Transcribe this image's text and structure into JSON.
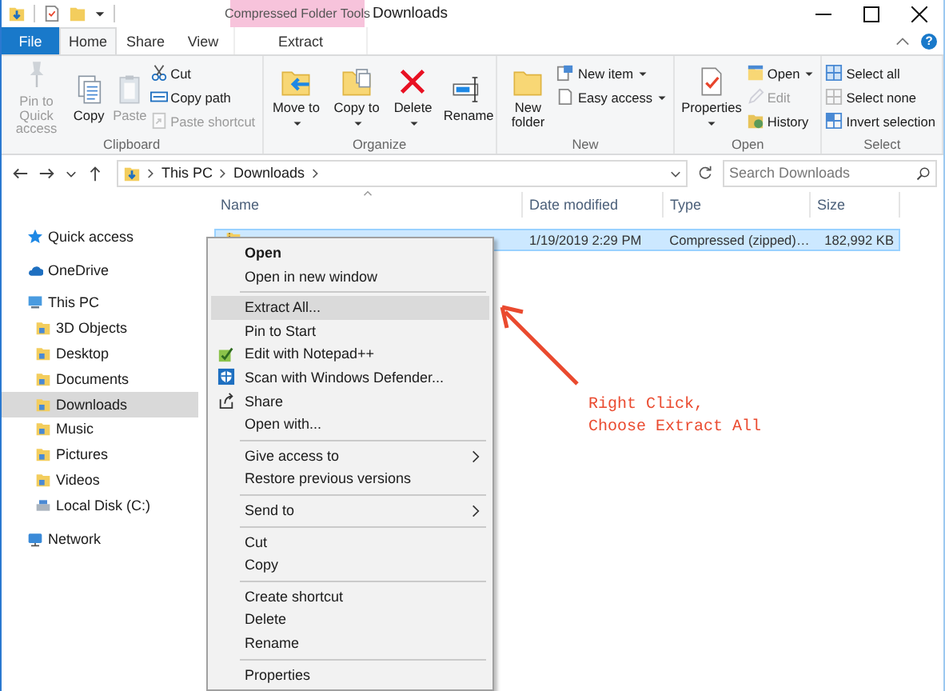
{
  "window": {
    "title": "Downloads",
    "context_tab_group": "Compressed Folder Tools",
    "help": "?"
  },
  "ribbon_tabs": [
    {
      "label": "File",
      "kind": "file",
      "selected": false
    },
    {
      "label": "Home",
      "kind": "tab",
      "selected": true
    },
    {
      "label": "Share",
      "kind": "tab",
      "selected": false
    },
    {
      "label": "View",
      "kind": "tab",
      "selected": false
    },
    {
      "label": "Extract",
      "kind": "context",
      "selected": false
    }
  ],
  "ribbon_groups": [
    {
      "label": "Clipboard",
      "columns": [
        {
          "kind": "large",
          "commands": [
            {
              "label": "Pin to Quick access",
              "disabled": true,
              "dropdown": false
            }
          ]
        },
        {
          "kind": "large",
          "commands": [
            {
              "label": "Copy",
              "disabled": false,
              "dropdown": false
            }
          ]
        },
        {
          "kind": "large",
          "commands": [
            {
              "label": "Paste",
              "disabled": true,
              "dropdown": false
            }
          ]
        },
        {
          "kind": "stack",
          "commands": [
            {
              "label": "Cut",
              "disabled": false,
              "dropdown": false
            },
            {
              "label": "Copy path",
              "disabled": false,
              "dropdown": false
            },
            {
              "label": "Paste shortcut",
              "disabled": true,
              "dropdown": false
            }
          ]
        }
      ]
    },
    {
      "label": "Organize",
      "columns": [
        {
          "kind": "large",
          "commands": [
            {
              "label": "Move to",
              "disabled": false,
              "dropdown": true
            }
          ]
        },
        {
          "kind": "large",
          "commands": [
            {
              "label": "Copy to",
              "disabled": false,
              "dropdown": true
            }
          ]
        },
        {
          "kind": "large",
          "commands": [
            {
              "label": "Delete",
              "disabled": false,
              "dropdown": true
            }
          ]
        },
        {
          "kind": "large",
          "commands": [
            {
              "label": "Rename",
              "disabled": false,
              "dropdown": false
            }
          ]
        }
      ]
    },
    {
      "label": "New",
      "columns": [
        {
          "kind": "large",
          "commands": [
            {
              "label": "New folder",
              "disabled": false,
              "dropdown": false
            }
          ]
        },
        {
          "kind": "stack",
          "commands": [
            {
              "label": "New item",
              "disabled": false,
              "dropdown": true
            },
            {
              "label": "Easy access",
              "disabled": false,
              "dropdown": true
            }
          ]
        }
      ]
    },
    {
      "label": "Open",
      "columns": [
        {
          "kind": "large",
          "commands": [
            {
              "label": "Properties",
              "disabled": false,
              "dropdown": true
            }
          ]
        },
        {
          "kind": "stack",
          "commands": [
            {
              "label": "Open",
              "disabled": false,
              "dropdown": true
            },
            {
              "label": "Edit",
              "disabled": true,
              "dropdown": false
            },
            {
              "label": "History",
              "disabled": false,
              "dropdown": false
            }
          ]
        }
      ]
    },
    {
      "label": "Select",
      "columns": [
        {
          "kind": "stack",
          "commands": [
            {
              "label": "Select all",
              "disabled": false,
              "dropdown": false
            },
            {
              "label": "Select none",
              "disabled": false,
              "dropdown": false
            },
            {
              "label": "Invert selection",
              "disabled": false,
              "dropdown": false
            }
          ]
        }
      ]
    }
  ],
  "address": {
    "crumbs": [
      "This PC",
      "Downloads"
    ]
  },
  "search": {
    "placeholder": "Search Downloads"
  },
  "columns": [
    "Name",
    "Date modified",
    "Type",
    "Size"
  ],
  "files": [
    {
      "selected": true,
      "date_modified": "1/19/2019 2:29 PM",
      "type": "Compressed (zipped)…",
      "size": "182,992 KB"
    }
  ],
  "sidebar": [
    {
      "label": "Quick access",
      "selected": false
    },
    {
      "label": "OneDrive",
      "selected": false
    },
    {
      "label": "This PC",
      "selected": false,
      "children": [
        {
          "label": "3D Objects",
          "selected": false
        },
        {
          "label": "Desktop",
          "selected": false
        },
        {
          "label": "Documents",
          "selected": false
        },
        {
          "label": "Downloads",
          "selected": true
        },
        {
          "label": "Music",
          "selected": false
        },
        {
          "label": "Pictures",
          "selected": false
        },
        {
          "label": "Videos",
          "selected": false
        },
        {
          "label": "Local Disk (C:)",
          "selected": false
        }
      ]
    },
    {
      "label": "Network",
      "selected": false
    }
  ],
  "context_menu": {
    "sections": [
      [
        {
          "label": "Open",
          "default": true,
          "selected": false,
          "submenu": false
        },
        {
          "label": "Open in new window",
          "default": false,
          "selected": false,
          "submenu": false
        }
      ],
      [
        {
          "label": "Extract All...",
          "default": false,
          "selected": true,
          "submenu": false
        },
        {
          "label": "Pin to Start",
          "default": false,
          "selected": false,
          "submenu": false
        },
        {
          "label": "Edit with Notepad++",
          "default": false,
          "selected": false,
          "submenu": false
        },
        {
          "label": "Scan with Windows Defender...",
          "default": false,
          "selected": false,
          "submenu": false
        },
        {
          "label": "Share",
          "default": false,
          "selected": false,
          "submenu": false
        },
        {
          "label": "Open with...",
          "default": false,
          "selected": false,
          "submenu": false
        }
      ],
      [
        {
          "label": "Give access to",
          "default": false,
          "selected": false,
          "submenu": true
        },
        {
          "label": "Restore previous versions",
          "default": false,
          "selected": false,
          "submenu": false
        }
      ],
      [
        {
          "label": "Send to",
          "default": false,
          "selected": false,
          "submenu": true
        }
      ],
      [
        {
          "label": "Cut",
          "default": false,
          "selected": false,
          "submenu": false
        },
        {
          "label": "Copy",
          "default": false,
          "selected": false,
          "submenu": false
        }
      ],
      [
        {
          "label": "Create shortcut",
          "default": false,
          "selected": false,
          "submenu": false
        },
        {
          "label": "Delete",
          "default": false,
          "selected": false,
          "submenu": false
        },
        {
          "label": "Rename",
          "default": false,
          "selected": false,
          "submenu": false
        }
      ],
      [
        {
          "label": "Properties",
          "default": false,
          "selected": false,
          "submenu": false
        }
      ]
    ]
  },
  "annotation": {
    "lines": [
      "Right Click,",
      "Choose Extract All"
    ]
  }
}
